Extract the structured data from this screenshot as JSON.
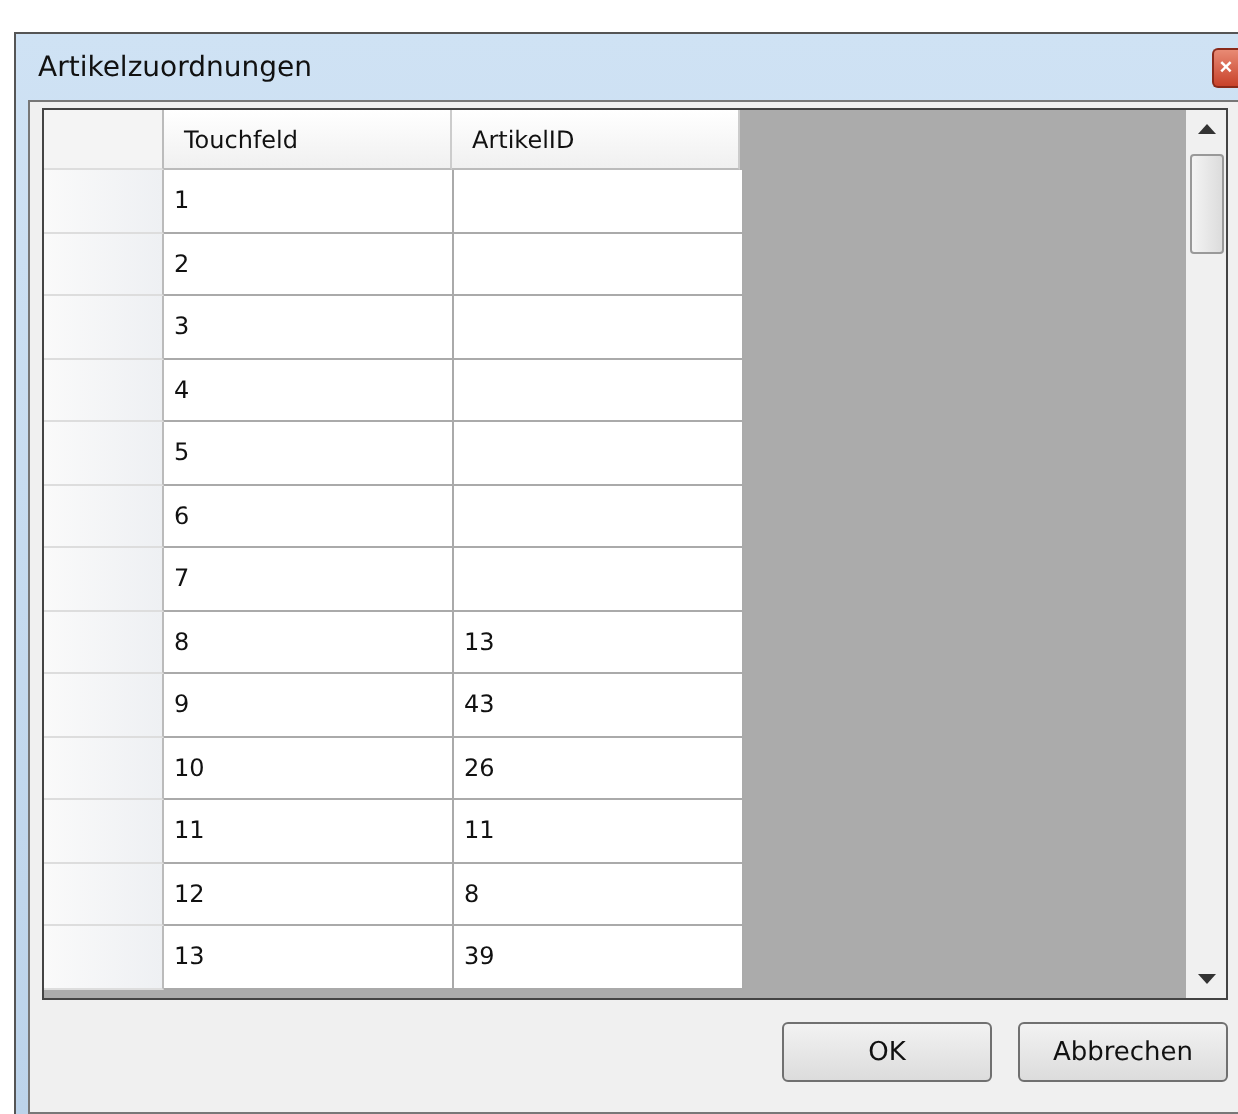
{
  "window": {
    "title": "Artikelzuordnungen",
    "close": "×"
  },
  "table": {
    "columns": [
      "Touchfeld",
      "ArtikelID"
    ],
    "rows": [
      {
        "touchfeld": "1",
        "artikel_id": ""
      },
      {
        "touchfeld": "2",
        "artikel_id": ""
      },
      {
        "touchfeld": "3",
        "artikel_id": ""
      },
      {
        "touchfeld": "4",
        "artikel_id": ""
      },
      {
        "touchfeld": "5",
        "artikel_id": ""
      },
      {
        "touchfeld": "6",
        "artikel_id": ""
      },
      {
        "touchfeld": "7",
        "artikel_id": ""
      },
      {
        "touchfeld": "8",
        "artikel_id": "13"
      },
      {
        "touchfeld": "9",
        "artikel_id": "43"
      },
      {
        "touchfeld": "10",
        "artikel_id": "26"
      },
      {
        "touchfeld": "11",
        "artikel_id": "11"
      },
      {
        "touchfeld": "12",
        "artikel_id": "8"
      },
      {
        "touchfeld": "13",
        "artikel_id": "39"
      }
    ]
  },
  "buttons": [
    "OK",
    "Abbrechen"
  ]
}
